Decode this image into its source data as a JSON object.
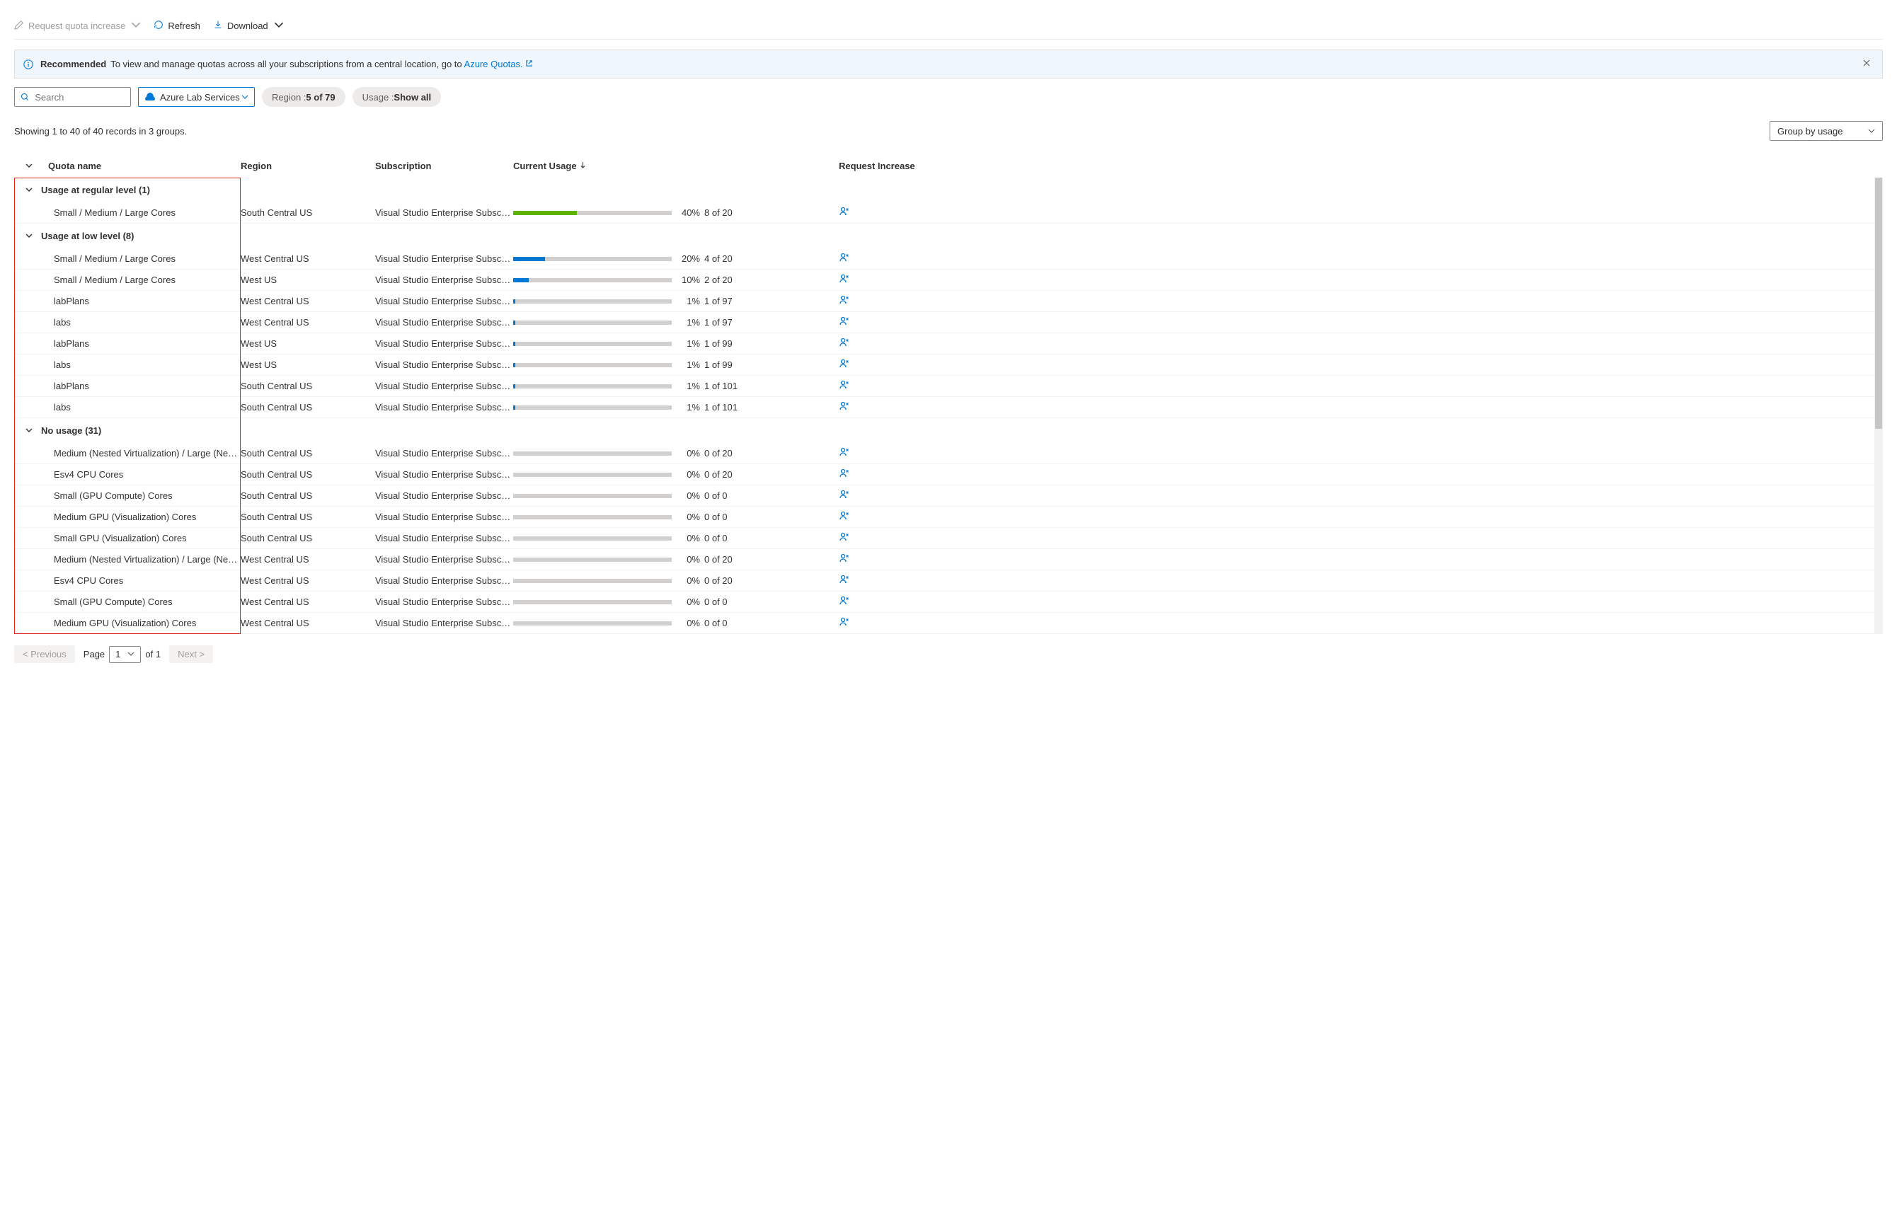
{
  "toolbar": {
    "request_label": "Request quota increase",
    "refresh_label": "Refresh",
    "download_label": "Download"
  },
  "banner": {
    "recommended": "Recommended",
    "message": "To view and manage quotas across all your subscriptions from a central location, go to ",
    "link_label": "Azure Quotas."
  },
  "filters": {
    "search_placeholder": "Search",
    "provider": "Azure Lab Services",
    "region_label": "Region : ",
    "region_value": "5 of 79",
    "usage_label": "Usage : ",
    "usage_value": "Show all"
  },
  "meta": {
    "count_text": "Showing 1 to 40 of 40 records in 3 groups.",
    "groupby_label": "Group by usage"
  },
  "headers": {
    "name": "Quota name",
    "region": "Region",
    "subscription": "Subscription",
    "usage": "Current Usage",
    "request": "Request Increase"
  },
  "groups": [
    {
      "title": "Usage at regular level (1)",
      "rows": [
        {
          "name": "Small / Medium / Large Cores",
          "region": "South Central US",
          "sub": "Visual Studio Enterprise Subscri…",
          "pct": 40,
          "pct_label": "40%",
          "of": "8 of 20",
          "color": "#5db300"
        }
      ]
    },
    {
      "title": "Usage at low level (8)",
      "rows": [
        {
          "name": "Small / Medium / Large Cores",
          "region": "West Central US",
          "sub": "Visual Studio Enterprise Subscri…",
          "pct": 20,
          "pct_label": "20%",
          "of": "4 of 20",
          "color": "#0078d4"
        },
        {
          "name": "Small / Medium / Large Cores",
          "region": "West US",
          "sub": "Visual Studio Enterprise Subscri…",
          "pct": 10,
          "pct_label": "10%",
          "of": "2 of 20",
          "color": "#0078d4"
        },
        {
          "name": "labPlans",
          "region": "West Central US",
          "sub": "Visual Studio Enterprise Subscri…",
          "pct": 1,
          "pct_label": "1%",
          "of": "1 of 97",
          "color": "#0078d4"
        },
        {
          "name": "labs",
          "region": "West Central US",
          "sub": "Visual Studio Enterprise Subscri…",
          "pct": 1,
          "pct_label": "1%",
          "of": "1 of 97",
          "color": "#0078d4"
        },
        {
          "name": "labPlans",
          "region": "West US",
          "sub": "Visual Studio Enterprise Subscri…",
          "pct": 1,
          "pct_label": "1%",
          "of": "1 of 99",
          "color": "#0078d4"
        },
        {
          "name": "labs",
          "region": "West US",
          "sub": "Visual Studio Enterprise Subscri…",
          "pct": 1,
          "pct_label": "1%",
          "of": "1 of 99",
          "color": "#0078d4"
        },
        {
          "name": "labPlans",
          "region": "South Central US",
          "sub": "Visual Studio Enterprise Subscri…",
          "pct": 1,
          "pct_label": "1%",
          "of": "1 of 101",
          "color": "#0078d4"
        },
        {
          "name": "labs",
          "region": "South Central US",
          "sub": "Visual Studio Enterprise Subscri…",
          "pct": 1,
          "pct_label": "1%",
          "of": "1 of 101",
          "color": "#0078d4"
        }
      ]
    },
    {
      "title": "No usage (31)",
      "rows": [
        {
          "name": "Medium (Nested Virtualization) / Large (Nested …",
          "region": "South Central US",
          "sub": "Visual Studio Enterprise Subscri…",
          "pct": 0,
          "pct_label": "0%",
          "of": "0 of 20",
          "color": "#0078d4"
        },
        {
          "name": "Esv4 CPU Cores",
          "region": "South Central US",
          "sub": "Visual Studio Enterprise Subscri…",
          "pct": 0,
          "pct_label": "0%",
          "of": "0 of 20",
          "color": "#0078d4"
        },
        {
          "name": "Small (GPU Compute) Cores",
          "region": "South Central US",
          "sub": "Visual Studio Enterprise Subscri…",
          "pct": 0,
          "pct_label": "0%",
          "of": "0 of 0",
          "color": "#0078d4"
        },
        {
          "name": "Medium GPU (Visualization) Cores",
          "region": "South Central US",
          "sub": "Visual Studio Enterprise Subscri…",
          "pct": 0,
          "pct_label": "0%",
          "of": "0 of 0",
          "color": "#0078d4"
        },
        {
          "name": "Small GPU (Visualization) Cores",
          "region": "South Central US",
          "sub": "Visual Studio Enterprise Subscri…",
          "pct": 0,
          "pct_label": "0%",
          "of": "0 of 0",
          "color": "#0078d4"
        },
        {
          "name": "Medium (Nested Virtualization) / Large (Nested …",
          "region": "West Central US",
          "sub": "Visual Studio Enterprise Subscri…",
          "pct": 0,
          "pct_label": "0%",
          "of": "0 of 20",
          "color": "#0078d4"
        },
        {
          "name": "Esv4 CPU Cores",
          "region": "West Central US",
          "sub": "Visual Studio Enterprise Subscri…",
          "pct": 0,
          "pct_label": "0%",
          "of": "0 of 20",
          "color": "#0078d4"
        },
        {
          "name": "Small (GPU Compute) Cores",
          "region": "West Central US",
          "sub": "Visual Studio Enterprise Subscri…",
          "pct": 0,
          "pct_label": "0%",
          "of": "0 of 0",
          "color": "#0078d4"
        },
        {
          "name": "Medium GPU (Visualization) Cores",
          "region": "West Central US",
          "sub": "Visual Studio Enterprise Subscri…",
          "pct": 0,
          "pct_label": "0%",
          "of": "0 of 0",
          "color": "#0078d4"
        }
      ]
    }
  ],
  "pager": {
    "prev": "< Previous",
    "page_word": "Page",
    "page_num": "1",
    "of_text": "of 1",
    "next": "Next >"
  }
}
